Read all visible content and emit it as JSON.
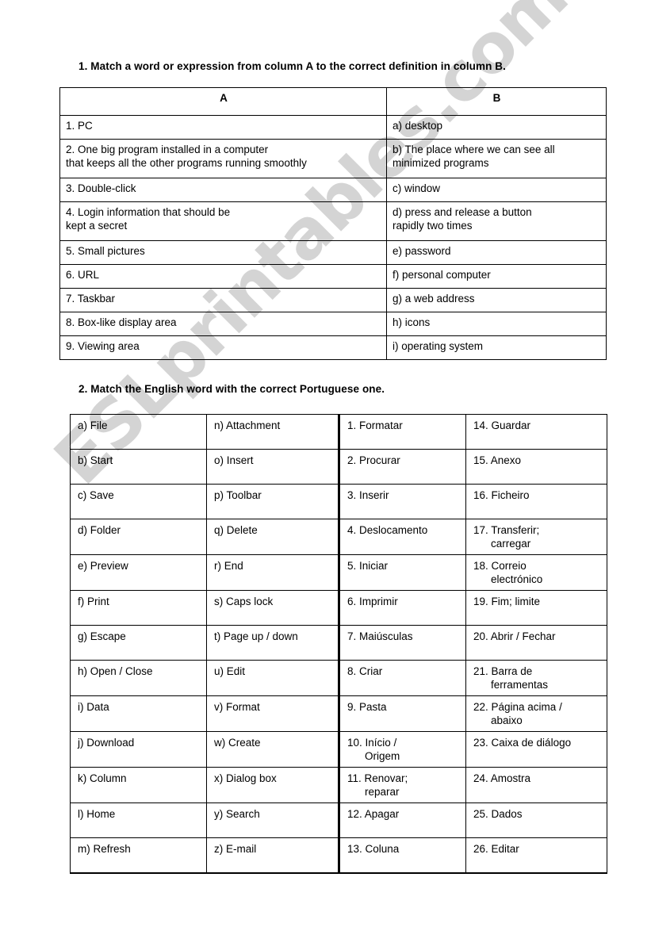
{
  "watermark": {
    "text": "ESLprintables.com",
    "color": "#d4d4d4"
  },
  "exercise1": {
    "heading": "1. Match a word or expression from column A to the correct definition in column B.",
    "headers": {
      "a": "A",
      "b": "B"
    },
    "rows": [
      {
        "a1": "1. PC",
        "a2": "",
        "b1": "a) desktop",
        "b2": ""
      },
      {
        "a1": "2. One big program installed in a computer",
        "a2": "that keeps all the other programs running smoothly",
        "b1": "b) The place where we can see all",
        "b2": "minimized programs"
      },
      {
        "a1": "3. Double-click",
        "a2": "",
        "b1": "c) window",
        "b2": ""
      },
      {
        "a1": "4. Login information that should be",
        "a2": "kept a secret",
        "b1": "d) press and release a button",
        "b2": "rapidly two times"
      },
      {
        "a1": "5. Small pictures",
        "a2": "",
        "b1": "e) password",
        "b2": ""
      },
      {
        "a1": "6. URL",
        "a2": "",
        "b1": "f) personal computer",
        "b2": ""
      },
      {
        "a1": "7. Taskbar",
        "a2": "",
        "b1": "g) a web address",
        "b2": ""
      },
      {
        "a1": "8. Box-like display area",
        "a2": "",
        "b1": "h) icons",
        "b2": ""
      },
      {
        "a1": "9. Viewing area",
        "a2": "",
        "b1": "i) operating system",
        "b2": ""
      }
    ]
  },
  "exercise2": {
    "heading": "2. Match the English word with the correct Portuguese one.",
    "rows": [
      {
        "c1": "a) File",
        "c2": "n) Attachment",
        "c3": "1. Formatar",
        "c3b": "",
        "c4": "14. Guardar",
        "c4b": ""
      },
      {
        "c1": "b) Start",
        "c2": "o) Insert",
        "c3": "2. Procurar",
        "c3b": "",
        "c4": "15. Anexo",
        "c4b": ""
      },
      {
        "c1": "c) Save",
        "c2": "p) Toolbar",
        "c3": "3. Inserir",
        "c3b": "",
        "c4": "16. Ficheiro",
        "c4b": ""
      },
      {
        "c1": "d) Folder",
        "c2": "q) Delete",
        "c3": "4. Deslocamento",
        "c3b": "",
        "c4": "17. Transferir;",
        "c4b": "carregar"
      },
      {
        "c1": "e) Preview",
        "c2": "r) End",
        "c3": "5. Iniciar",
        "c3b": "",
        "c4": "18. Correio",
        "c4b": "electrónico"
      },
      {
        "c1": "f) Print",
        "c2": "s) Caps lock",
        "c3": "6. Imprimir",
        "c3b": "",
        "c4": "19. Fim; limite",
        "c4b": ""
      },
      {
        "c1": "g) Escape",
        "c2": "t) Page up / down",
        "c3": "7. Maiúsculas",
        "c3b": "",
        "c4": "20. Abrir / Fechar",
        "c4b": ""
      },
      {
        "c1": "h) Open / Close",
        "c2": "u) Edit",
        "c3": "8. Criar",
        "c3b": "",
        "c4": "21. Barra de",
        "c4b": "ferramentas"
      },
      {
        "c1": "i) Data",
        "c2": "v) Format",
        "c3": "9. Pasta",
        "c3b": "",
        "c4": "22. Página acima /",
        "c4b": "abaixo"
      },
      {
        "c1": "j) Download",
        "c2": "w) Create",
        "c3": "10. Início /",
        "c3b": "Origem",
        "c4": "23. Caixa de diálogo",
        "c4b": ""
      },
      {
        "c1": "k) Column",
        "c2": "x) Dialog box",
        "c3": "11. Renovar;",
        "c3b": "reparar",
        "c4": "24. Amostra",
        "c4b": ""
      },
      {
        "c1": "l) Home",
        "c2": "y) Search",
        "c3": "12. Apagar",
        "c3b": "",
        "c4": "25. Dados",
        "c4b": ""
      },
      {
        "c1": "m) Refresh",
        "c2": "z) E-mail",
        "c3": "13. Coluna",
        "c3b": "",
        "c4": "26. Editar",
        "c4b": ""
      }
    ]
  }
}
